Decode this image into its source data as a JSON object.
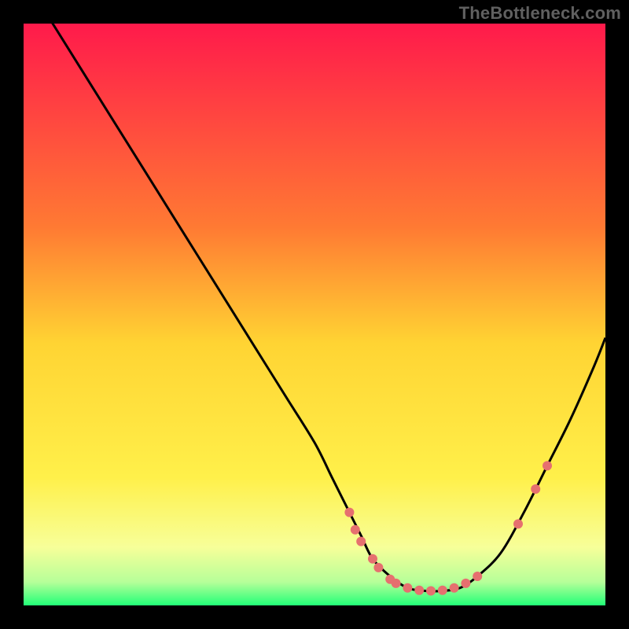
{
  "watermark": "TheBottleneck.com",
  "chart_data": {
    "type": "line",
    "title": "",
    "xlabel": "",
    "ylabel": "",
    "xlim": [
      0,
      100
    ],
    "ylim": [
      0,
      100
    ],
    "gradient_stops": [
      {
        "offset": 0,
        "color": "#ff1a4b"
      },
      {
        "offset": 35,
        "color": "#ff7a33"
      },
      {
        "offset": 55,
        "color": "#ffd433"
      },
      {
        "offset": 78,
        "color": "#fff04a"
      },
      {
        "offset": 90,
        "color": "#f7ff99"
      },
      {
        "offset": 96,
        "color": "#b6ff99"
      },
      {
        "offset": 100,
        "color": "#22ff77"
      }
    ],
    "series": [
      {
        "name": "bottleneck-curve",
        "color": "#000000",
        "x": [
          0,
          5,
          10,
          15,
          20,
          25,
          30,
          35,
          40,
          45,
          50,
          53,
          56,
          58,
          60,
          63,
          66,
          69,
          72,
          75,
          78,
          82,
          86,
          90,
          94,
          98,
          100
        ],
        "y": [
          108,
          100,
          92,
          84,
          76,
          68,
          60,
          52,
          44,
          36,
          28,
          22,
          16,
          12,
          8,
          5,
          3,
          2.5,
          2.5,
          3,
          5,
          9,
          16,
          24,
          32,
          41,
          46
        ]
      }
    ],
    "markers": {
      "name": "highlight-points",
      "color": "#e6706f",
      "radius": 6,
      "points": [
        {
          "x": 56,
          "y": 16
        },
        {
          "x": 57,
          "y": 13
        },
        {
          "x": 58,
          "y": 11
        },
        {
          "x": 60,
          "y": 8
        },
        {
          "x": 61,
          "y": 6.5
        },
        {
          "x": 63,
          "y": 4.5
        },
        {
          "x": 64,
          "y": 3.8
        },
        {
          "x": 66,
          "y": 3
        },
        {
          "x": 68,
          "y": 2.6
        },
        {
          "x": 70,
          "y": 2.5
        },
        {
          "x": 72,
          "y": 2.6
        },
        {
          "x": 74,
          "y": 3
        },
        {
          "x": 76,
          "y": 3.8
        },
        {
          "x": 78,
          "y": 5
        },
        {
          "x": 85,
          "y": 14
        },
        {
          "x": 88,
          "y": 20
        },
        {
          "x": 90,
          "y": 24
        }
      ]
    }
  }
}
